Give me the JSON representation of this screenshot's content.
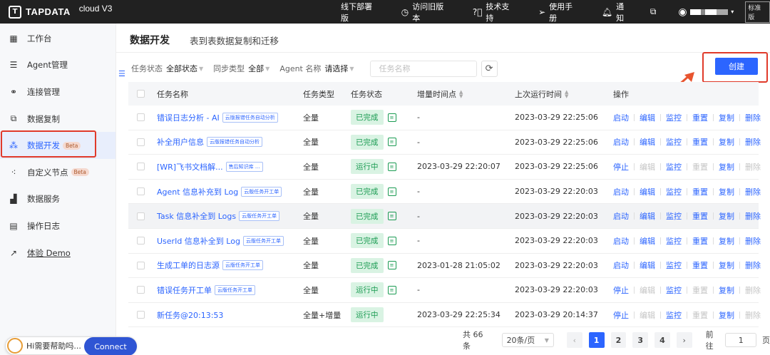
{
  "topbar": {
    "logo_text": "TAPDATA",
    "version": "cloud V3",
    "nav": [
      {
        "label": "线下部署版"
      },
      {
        "label": "访问旧版本"
      },
      {
        "label": "技术支持"
      },
      {
        "label": "使用手册"
      },
      {
        "label": "通知"
      }
    ],
    "plan_badge": "标准版"
  },
  "sidebar": {
    "items": [
      {
        "label": "工作台"
      },
      {
        "label": "Agent管理"
      },
      {
        "label": "连接管理"
      },
      {
        "label": "数据复制"
      },
      {
        "label": "数据开发",
        "badge": "Beta"
      },
      {
        "label": "自定义节点",
        "badge": "Beta"
      },
      {
        "label": "数据服务"
      },
      {
        "label": "操作日志"
      },
      {
        "label": "体验 Demo"
      }
    ]
  },
  "chat": {
    "text": "Hi需要帮助吗...",
    "button": "Connect"
  },
  "main": {
    "title": "数据开发",
    "subtitle": "表到表数据复制和迁移",
    "create_label": "创建",
    "filters": {
      "status_label": "任务状态",
      "status_value": "全部状态",
      "sync_label": "同步类型",
      "sync_value": "全部",
      "agent_label": "Agent 名称",
      "agent_value": "请选择",
      "search_placeholder": "任务名称"
    },
    "columns": {
      "name": "任务名称",
      "type": "任务类型",
      "status": "任务状态",
      "increment": "增量时间点",
      "last_run": "上次运行时间",
      "actions": "操作"
    },
    "rows": [
      {
        "name": "错误日志分析 - AI",
        "tag": "云版报错任务自动分析",
        "type": "全量",
        "status": "已完成",
        "increment": "-",
        "last_run": "2023-03-29 22:25:06",
        "ops": [
          "启动",
          "编辑",
          "监控",
          "重置",
          "复制",
          "删除"
        ]
      },
      {
        "name": "补全用户信息",
        "tag": "云版报错任务自动分析",
        "type": "全量",
        "status": "已完成",
        "increment": "-",
        "last_run": "2023-03-29 22:25:06",
        "ops": [
          "启动",
          "编辑",
          "监控",
          "重置",
          "复制",
          "删除"
        ]
      },
      {
        "name": "[WR]飞书文档解...",
        "tag": "售后知识库 ...",
        "type": "全量",
        "status": "运行中",
        "increment": "2023-03-29 22:20:07",
        "last_run": "2023-03-29 22:25:06",
        "ops": [
          "停止",
          "编辑",
          "监控",
          "重置",
          "复制",
          "删除"
        ]
      },
      {
        "name": "Agent 信息补充到 Log",
        "tag": "云版任务开工单",
        "type": "全量",
        "status": "已完成",
        "increment": "-",
        "last_run": "2023-03-29 22:20:03",
        "ops": [
          "启动",
          "编辑",
          "监控",
          "重置",
          "复制",
          "删除"
        ]
      },
      {
        "name": "Task 信息补全到 Logs",
        "tag": "云版任务开工单",
        "type": "全量",
        "status": "已完成",
        "increment": "-",
        "last_run": "2023-03-29 22:20:03",
        "ops": [
          "启动",
          "编辑",
          "监控",
          "重置",
          "复制",
          "删除"
        ]
      },
      {
        "name": "UserId 信息补全到 Log",
        "tag": "云版任务开工单",
        "type": "全量",
        "status": "已完成",
        "increment": "-",
        "last_run": "2023-03-29 22:20:03",
        "ops": [
          "启动",
          "编辑",
          "监控",
          "重置",
          "复制",
          "删除"
        ]
      },
      {
        "name": "生成工单的日志源",
        "tag": "云版任务开工单",
        "type": "全量",
        "status": "已完成",
        "increment": "2023-01-28 21:05:02",
        "last_run": "2023-03-29 22:20:03",
        "ops": [
          "启动",
          "编辑",
          "监控",
          "重置",
          "复制",
          "删除"
        ]
      },
      {
        "name": "错误任务开工单",
        "tag": "云版任务开工单",
        "type": "全量",
        "status": "运行中",
        "increment": "-",
        "last_run": "2023-03-29 22:20:03",
        "ops": [
          "停止",
          "编辑",
          "监控",
          "重置",
          "复制",
          "删除"
        ]
      },
      {
        "name": "新任务@20:13:53",
        "tag": "",
        "type": "全量+增量",
        "status": "运行中",
        "increment": "2023-03-29 22:25:34",
        "last_run": "2023-03-29 20:14:37",
        "ops": [
          "停止",
          "编辑",
          "监控",
          "重置",
          "复制",
          "删除"
        ]
      }
    ],
    "pagination": {
      "total": "共 66 条",
      "page_size": "20条/页",
      "pages": [
        "1",
        "2",
        "3",
        "4"
      ],
      "goto_label": "前往",
      "goto_value": "1",
      "page_unit": "页"
    }
  }
}
